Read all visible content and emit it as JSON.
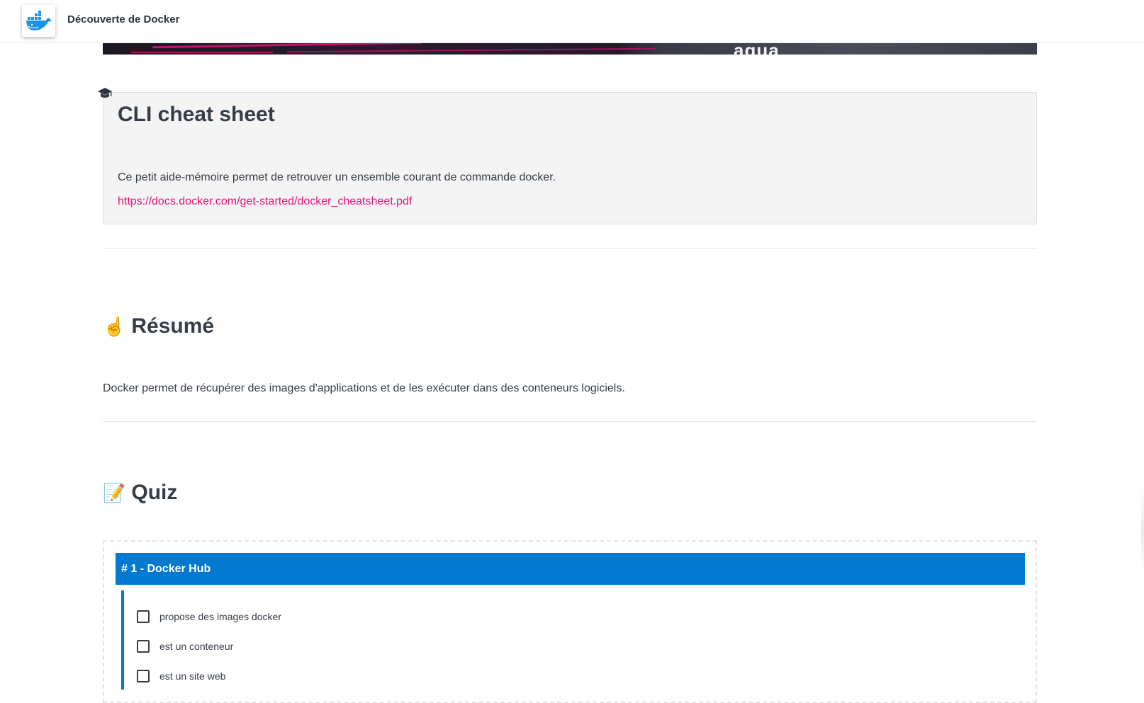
{
  "app": {
    "title": "Découverte de Docker",
    "logo_icon": "docker-whale-icon"
  },
  "banner": {
    "brand_text": "aqua"
  },
  "cheat_sheet": {
    "icon": "graduation-cap-icon",
    "title": "CLI cheat sheet",
    "description": "Ce petit aide-mémoire permet de retrouver un ensemble courant de commande docker.",
    "link": "https://docs.docker.com/get-started/docker_cheatsheet.pdf"
  },
  "resume": {
    "emoji": "☝️",
    "title": "Résumé",
    "text": "Docker permet de récupérer des images d'applications et de les exécuter dans des conteneurs logiciels."
  },
  "quiz": {
    "emoji": "📝",
    "title": "Quiz",
    "question": "# 1 - Docker Hub",
    "options": [
      {
        "label": "propose des images docker",
        "checked": false
      },
      {
        "label": "est un conteneur",
        "checked": false
      },
      {
        "label": "est un site web",
        "checked": false
      }
    ]
  },
  "colors": {
    "accent_blue": "#0179cf",
    "link_pink": "#e8137a",
    "text": "#363d47",
    "box_bg": "#f4f4f4"
  }
}
